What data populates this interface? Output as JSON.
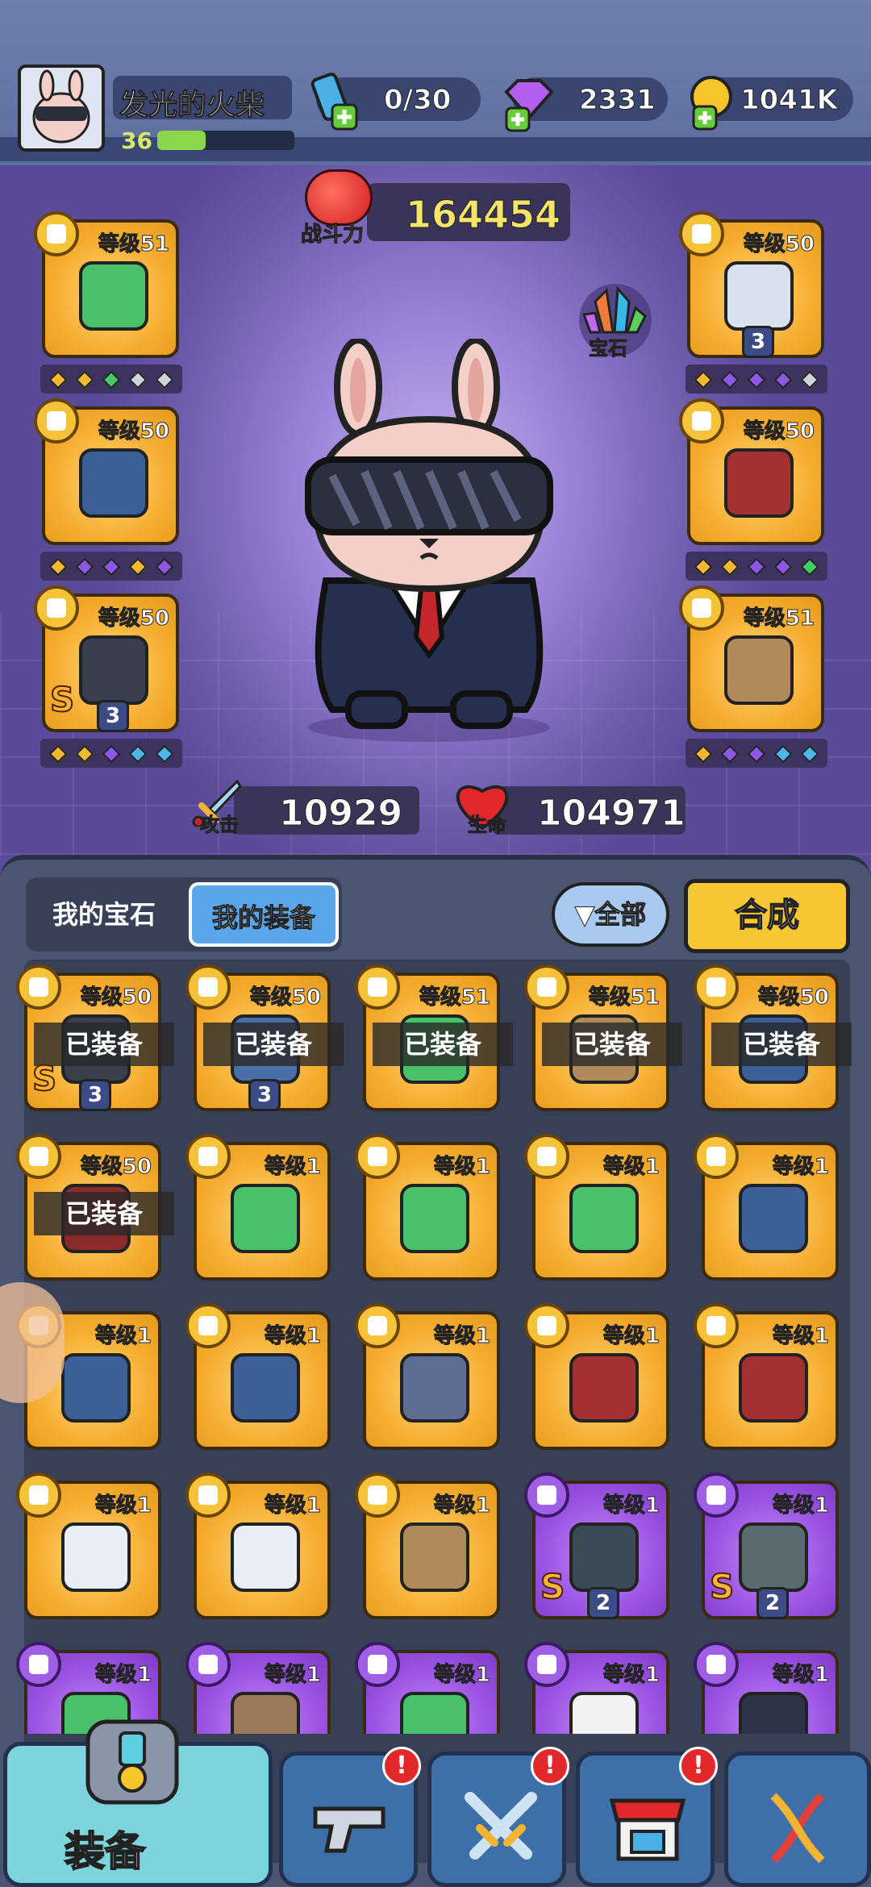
{
  "player": {
    "name": "发光的火柴",
    "level": "36",
    "xp_fraction": 0.35
  },
  "resources": {
    "energy": "0/30",
    "gems": "2331",
    "coins": "1041K"
  },
  "battle": {
    "power_label": "战斗力",
    "power": "164454",
    "gem_label": "宝石"
  },
  "stats": {
    "attack_label": "攻击",
    "attack": "10929",
    "hp_label": "生命",
    "hp": "104971"
  },
  "equipped": [
    {
      "level": "等级51",
      "side": "left",
      "type": "hat",
      "dots": [
        "#f5b930",
        "#f5b930",
        "#47c96a",
        "#cfd3da",
        "#cfd3da"
      ]
    },
    {
      "level": "等级50",
      "side": "left",
      "type": "collar",
      "dots": [
        "#f5b930",
        "#8c57e4",
        "#8c57e4",
        "#f5b930",
        "#8c57e4"
      ]
    },
    {
      "level": "等级50",
      "side": "left",
      "type": "glove",
      "badge": "S",
      "count": "3",
      "dots": [
        "#f5b930",
        "#f5b930",
        "#8c57e4",
        "#4db7ea",
        "#4db7ea"
      ]
    },
    {
      "level": "等级50",
      "side": "right",
      "type": "shirt",
      "count": "3",
      "dots": [
        "#f5b930",
        "#8c57e4",
        "#8c57e4",
        "#8c57e4",
        "#cfd3da"
      ]
    },
    {
      "level": "等级50",
      "side": "right",
      "type": "belt",
      "dots": [
        "#f5b930",
        "#f5b930",
        "#8c57e4",
        "#8c57e4",
        "#47c96a"
      ]
    },
    {
      "level": "等级51",
      "side": "right",
      "type": "boot",
      "dots": [
        "#f5b930",
        "#8c57e4",
        "#8c57e4",
        "#4db7ea",
        "#4db7ea"
      ]
    }
  ],
  "inventory_tabs": {
    "gems": "我的宝石",
    "equipment": "我的装备",
    "filter": "全部",
    "craft": "合成"
  },
  "equipped_label": "已装备",
  "inventory": [
    {
      "level": "等级50",
      "rarity": "gold",
      "color": "#3a3f4e",
      "equipped": true,
      "badge": "S",
      "count": "3"
    },
    {
      "level": "等级50",
      "rarity": "gold",
      "color": "#4a6fa8",
      "equipped": true,
      "count": "3"
    },
    {
      "level": "等级51",
      "rarity": "gold",
      "color": "#49c06a",
      "equipped": true
    },
    {
      "level": "等级51",
      "rarity": "gold",
      "color": "#b08a5a",
      "equipped": true
    },
    {
      "level": "等级50",
      "rarity": "gold",
      "color": "#3b5f96",
      "equipped": true
    },
    {
      "level": "等级50",
      "rarity": "gold",
      "color": "#8a2a2a",
      "equipped": true
    },
    {
      "level": "等级1",
      "rarity": "gold",
      "color": "#49c06a"
    },
    {
      "level": "等级1",
      "rarity": "gold",
      "color": "#49c06a"
    },
    {
      "level": "等级1",
      "rarity": "gold",
      "color": "#49c06a"
    },
    {
      "level": "等级1",
      "rarity": "gold",
      "color": "#3b5f96"
    },
    {
      "level": "等级1",
      "rarity": "gold",
      "color": "#3b5f96"
    },
    {
      "level": "等级1",
      "rarity": "gold",
      "color": "#3b5f96"
    },
    {
      "level": "等级1",
      "rarity": "gold",
      "color": "#5d6e92"
    },
    {
      "level": "等级1",
      "rarity": "gold",
      "color": "#a33030"
    },
    {
      "level": "等级1",
      "rarity": "gold",
      "color": "#a33030"
    },
    {
      "level": "等级1",
      "rarity": "gold",
      "color": "#e8eef6"
    },
    {
      "level": "等级1",
      "rarity": "gold",
      "color": "#e8eef6"
    },
    {
      "level": "等级1",
      "rarity": "gold",
      "color": "#b08a5a"
    },
    {
      "level": "等级1",
      "rarity": "purple",
      "color": "#3c4a55",
      "badge": "S",
      "count": "2"
    },
    {
      "level": "等级1",
      "rarity": "purple",
      "color": "#5a6a70",
      "badge": "S",
      "count": "2"
    },
    {
      "level": "等级1",
      "rarity": "purple",
      "color": "#49c06a"
    },
    {
      "level": "等级1",
      "rarity": "purple",
      "color": "#9a7a5a"
    },
    {
      "level": "等级1",
      "rarity": "purple",
      "color": "#49c06a"
    },
    {
      "level": "等级1",
      "rarity": "purple",
      "color": "#f2f2f2"
    },
    {
      "level": "等级1",
      "rarity": "purple",
      "color": "#2c3346"
    }
  ],
  "nav": {
    "equipment": "装备",
    "alert": "!"
  }
}
